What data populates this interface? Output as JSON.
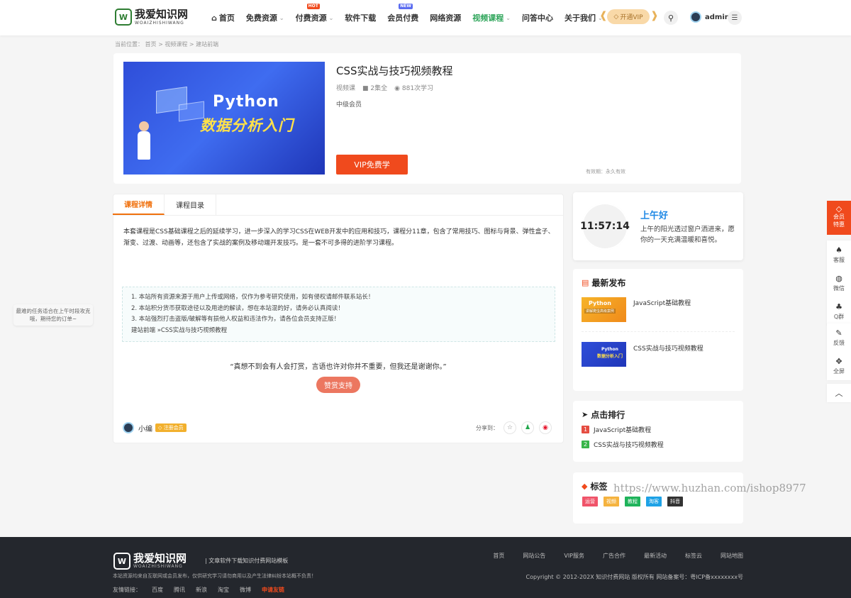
{
  "header": {
    "logo_text": "我爱知识网",
    "logo_sub": "WOAIZHISHIWANG",
    "logo_mark": "W",
    "nav": [
      {
        "label": "首页",
        "icon": "home-icon",
        "caret": false,
        "badge": ""
      },
      {
        "label": "免费资源",
        "caret": true,
        "badge": ""
      },
      {
        "label": "付费资源",
        "caret": true,
        "badge": "HOT"
      },
      {
        "label": "软件下载",
        "caret": false,
        "badge": ""
      },
      {
        "label": "会员付费",
        "caret": false,
        "badge": "NEW"
      },
      {
        "label": "网络资源",
        "caret": false,
        "badge": ""
      },
      {
        "label": "视频课程",
        "caret": true,
        "badge": "",
        "active": true
      },
      {
        "label": "问答中心",
        "caret": false,
        "badge": ""
      },
      {
        "label": "关于我们",
        "caret": true,
        "badge": ""
      }
    ],
    "vip_button": "开通VIP",
    "user_name": "admin",
    "colors": {
      "hot": "#f04a1d",
      "new": "#5b6cf0",
      "active": "#2ea55a"
    }
  },
  "breadcrumb": "当前位置：  首页 > 视频课程 > 建站前端",
  "course": {
    "image_title_1": "Python",
    "image_title_2": "数据分析入门",
    "title": "CSS实战与技巧视频教程",
    "type": "视频课",
    "episodes": "2集全",
    "views": "881次学习",
    "level": "中级会员",
    "learn_button": "VIP免费学",
    "validity": "有效期：永久有效"
  },
  "tabs": [
    "课程详情",
    "课程目录"
  ],
  "description": "本套课程是CSS基础课程之后的延续学习，进一步深入的学习CSS在WEB开发中的应用和技巧，课程分11章，包含了常用技巧、图标与背景、弹性盒子、渐变、过渡、动画等，还包含了实战的案例及移动端开发技巧。是一套不可多得的进阶学习课程。",
  "notice": [
    "1. 本站所有资源来源于用户上传或网络，仅作为参考研究使用，如有侵权请邮件联系站长！",
    "2. 本站积分货币获取途径以及用途的解读，想在本站混的好，请务必认真阅读！",
    "3. 本站强烈打击盗版/破解等有损他人权益和违法作为，请各位会员支持正版！",
    "建站前端 »CSS实战与技巧视频教程"
  ],
  "quote": "“真想不到会有人会打赏，言语也许对你并不重要，但我还是谢谢你。”",
  "reward_button": "赞赏支持",
  "author": {
    "name": "小编",
    "badge": "注册会员"
  },
  "share_label": "分享到：",
  "sidebar": {
    "clock": "11:57:14",
    "greeting": "上午好",
    "greeting_text": "上午的阳光透过窗户洒进来，愿你的一天充满温暖和喜悦。",
    "latest_title": "最新发布",
    "latest": [
      {
        "label": "JavaScript基础教程",
        "thumb_text": "Python",
        "thumb_sub": "讲解爬虫高级案例"
      },
      {
        "label": "CSS实战与技巧视频教程",
        "thumb_text": "Python",
        "thumb_sub": "数据分析入门"
      }
    ],
    "rank_title": "点击排行",
    "rank": [
      {
        "n": "1",
        "label": "JavaScript基础教程",
        "color": "#e54d42"
      },
      {
        "n": "2",
        "label": "CSS实战与技巧视频教程",
        "color": "#39b54a"
      }
    ],
    "tags_title": "标签",
    "tags": [
      {
        "label": "运营",
        "color": "#f0546a"
      },
      {
        "label": "视频",
        "color": "#f5b33f"
      },
      {
        "label": "教程",
        "color": "#1fb35b"
      },
      {
        "label": "淘客",
        "color": "#1ea2e6"
      },
      {
        "label": "抖音",
        "color": "#333333"
      }
    ]
  },
  "watermark": "https://www.huzhan.com/ishop8977",
  "float_tip": "最难的任务适合在上午时段攻克哦，期待您的订单~",
  "right_bar": {
    "vip": "会员特惠",
    "items": [
      "客服",
      "微信",
      "Q群",
      "反馈",
      "全屏"
    ]
  },
  "footer": {
    "logo_text": "我爱知识网",
    "logo_sub": "WOAIZHISHIWANG",
    "slogan": "|  文章软件下载知识付费网站模板",
    "note": "本站资源均来自互联网或会员发布，仅供研究学习请勿商用以及产生法律纠纷本站概不负责！",
    "links": [
      "首页",
      "网站公告",
      "VIP服务",
      "广告合作",
      "最新活动",
      "标签云",
      "网站地图"
    ],
    "copyright": "Copyright © 2012-202X 知识付费网站 版权所有 网站备案号：粤ICP备xxxxxxxx号",
    "friends_label": "友情链接：",
    "friends": [
      "百度",
      "腾讯",
      "新浪",
      "淘宝",
      "微博"
    ],
    "apply": "申请友链"
  }
}
